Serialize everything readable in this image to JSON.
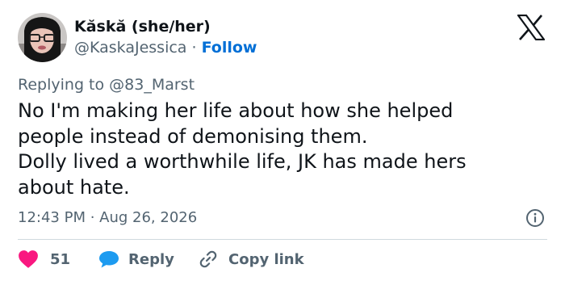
{
  "user": {
    "display_name": "Kăskă (she/her)",
    "handle": "@KaskaJessica",
    "separator": "·",
    "follow_label": "Follow"
  },
  "reply_context": {
    "prefix": "Replying to ",
    "mention": "@83_Marst"
  },
  "tweet": {
    "lines": [
      "No I'm making her life about how she helped",
      "people instead of demonising them.",
      "Dolly lived a worthwhile life, JK has made hers",
      "about hate."
    ],
    "timestamp": "12:43 PM · Aug 26, 2026"
  },
  "actions": {
    "like_count": "51",
    "reply_label": "Reply",
    "copy_link_label": "Copy link"
  },
  "icons": {
    "logo": "x-logo-icon",
    "info": "info-icon",
    "like": "heart-icon",
    "reply": "speech-bubble-icon",
    "copy": "link-icon"
  },
  "colors": {
    "text": "#0f1419",
    "secondary": "#536471",
    "link": "#006fd6",
    "heart": "#f91880",
    "reply_bubble": "#1d9bf0",
    "divider": "#cfd9de"
  }
}
